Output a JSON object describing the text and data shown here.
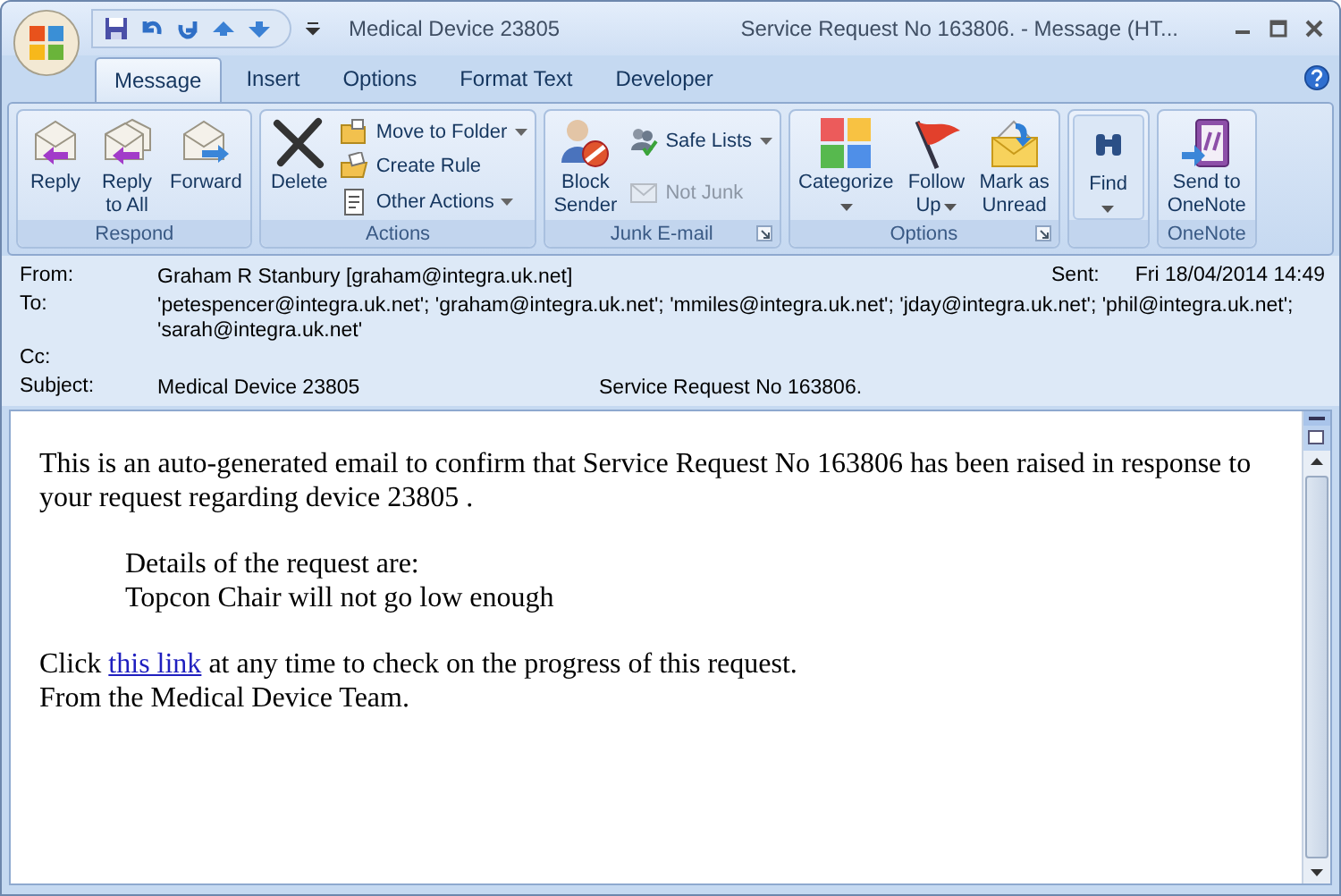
{
  "window": {
    "title_left": "Medical Device 23805",
    "title_right": "Service Request No 163806. - Message (HT..."
  },
  "tabs": [
    {
      "label": "Message",
      "selected": true
    },
    {
      "label": "Insert",
      "selected": false
    },
    {
      "label": "Options",
      "selected": false
    },
    {
      "label": "Format Text",
      "selected": false
    },
    {
      "label": "Developer",
      "selected": false
    }
  ],
  "ribbon": [
    {
      "label": "Respond",
      "launcher": false,
      "buttons": [
        {
          "kind": "large",
          "lines": [
            "Reply"
          ],
          "dropdown": false,
          "disabled": false
        },
        {
          "kind": "large",
          "lines": [
            "Reply",
            "to All"
          ],
          "dropdown": false,
          "disabled": false
        },
        {
          "kind": "large",
          "lines": [
            "Forward"
          ],
          "dropdown": false,
          "disabled": false
        }
      ]
    },
    {
      "label": "Actions",
      "launcher": false,
      "buttons": [
        {
          "kind": "large",
          "lines": [
            "Delete"
          ],
          "dropdown": false,
          "disabled": false
        },
        {
          "kind": "small",
          "lines": [
            "Move to Folder"
          ],
          "dropdown": true,
          "disabled": false
        },
        {
          "kind": "small",
          "lines": [
            "Create Rule"
          ],
          "dropdown": false,
          "disabled": false
        },
        {
          "kind": "small",
          "lines": [
            "Other Actions"
          ],
          "dropdown": true,
          "disabled": false
        }
      ]
    },
    {
      "label": "Junk E-mail",
      "launcher": true,
      "buttons": [
        {
          "kind": "large",
          "lines": [
            "Block",
            "Sender"
          ],
          "dropdown": false,
          "disabled": false
        },
        {
          "kind": "small",
          "lines": [
            "Safe Lists"
          ],
          "dropdown": true,
          "disabled": false
        },
        {
          "kind": "small",
          "lines": [
            "Not Junk"
          ],
          "dropdown": false,
          "disabled": true
        }
      ]
    },
    {
      "label": "Options",
      "launcher": true,
      "buttons": [
        {
          "kind": "large",
          "lines": [
            "Categorize"
          ],
          "dropdown": true,
          "disabled": false
        },
        {
          "kind": "large",
          "lines": [
            "Follow",
            "Up"
          ],
          "dropdown": true,
          "disabled": false
        },
        {
          "kind": "large",
          "lines": [
            "Mark as",
            "Unread"
          ],
          "dropdown": false,
          "disabled": false
        }
      ]
    },
    {
      "launcher": false,
      "buttons": [
        {
          "kind": "large",
          "lines": [
            "Find"
          ],
          "dropdown": true,
          "disabled": false
        }
      ]
    },
    {
      "label": "OneNote",
      "launcher": false,
      "buttons": [
        {
          "kind": "large",
          "lines": [
            "Send to",
            "OneNote"
          ],
          "dropdown": false,
          "disabled": false
        }
      ]
    }
  ],
  "header": {
    "from_label": "From:",
    "from": "Graham R Stanbury [graham@integra.uk.net]",
    "sent_label": "Sent:",
    "sent": "Fri 18/04/2014 14:49",
    "to_label": "To:",
    "to": "'petespencer@integra.uk.net'; 'graham@integra.uk.net'; 'mmiles@integra.uk.net'; 'jday@integra.uk.net'; 'phil@integra.uk.net'; 'sarah@integra.uk.net'",
    "cc_label": "Cc:",
    "subject_label": "Subject:",
    "subject": "Medical Device 23805",
    "subject_extra": "Service Request No 163806."
  },
  "body": {
    "intro": "This is an auto-generated email to confirm that Service Request No 163806 has been raised in response to your request regarding device 23805 .",
    "details": [
      "Details of the request are:",
      "Topcon Chair will not go low enough"
    ],
    "click_before": "Click",
    "link": "this link",
    "click_after": "at any time to check on the progress of this request.",
    "signoff": "From the Medical Device Team."
  }
}
